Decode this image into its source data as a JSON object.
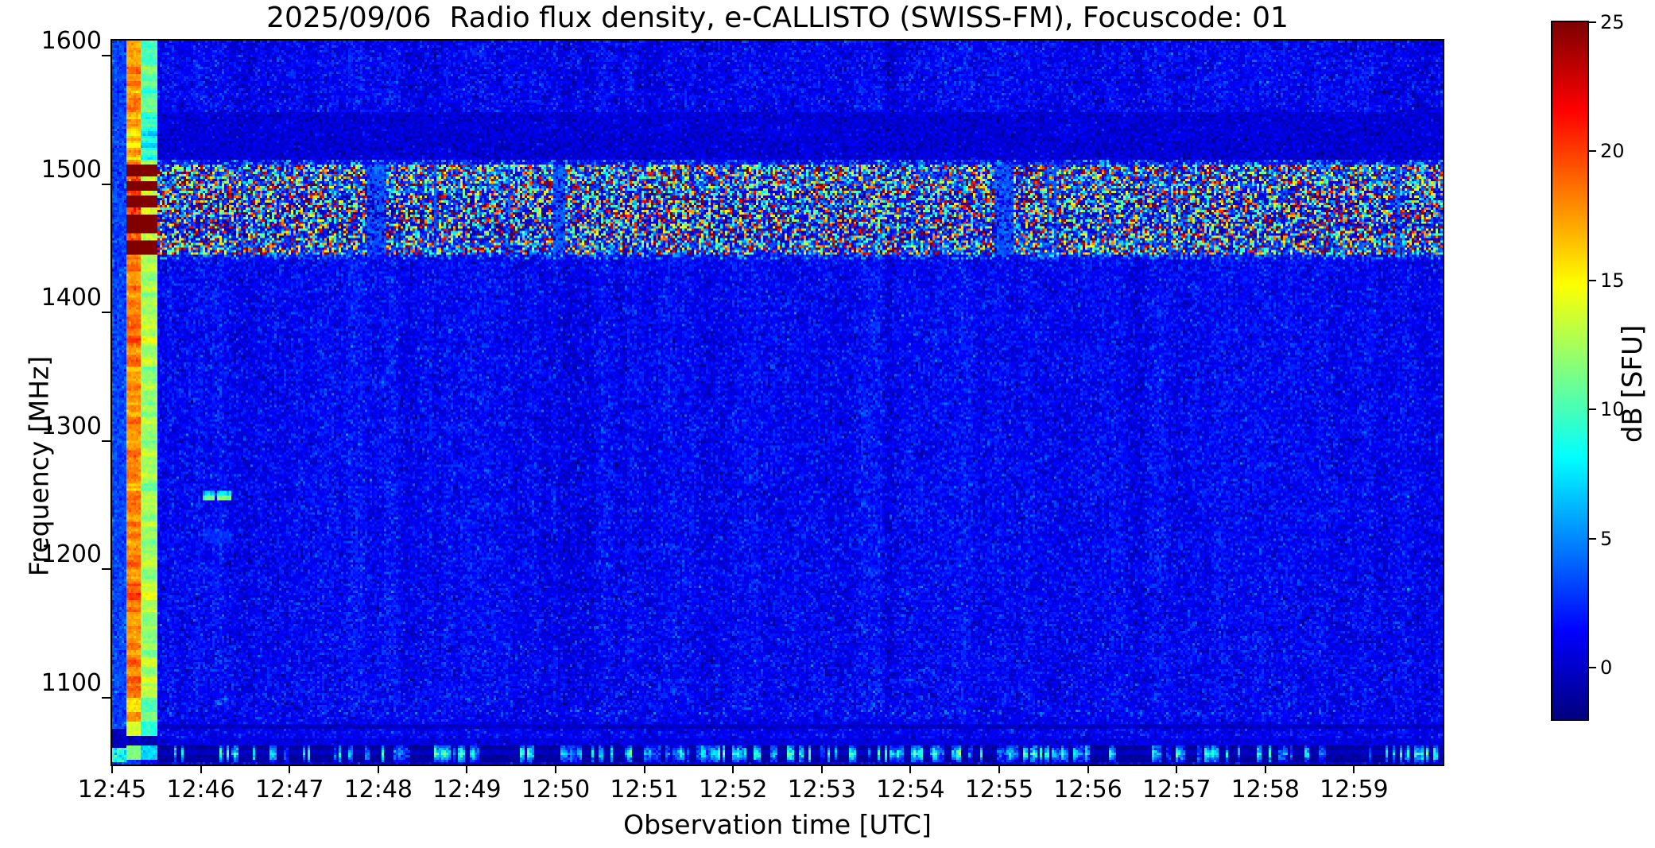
{
  "page": {
    "background": "#ffffff"
  },
  "chart_data": {
    "type": "heatmap",
    "subtype": "radio-spectrogram",
    "title": "2025/09/06  Radio flux density, e-CALLISTO (SWISS-FM), Focuscode: 01",
    "xlabel": "Observation time [UTC]",
    "ylabel": "Frequency [MHz]",
    "colorbar_label": "dB [SFU]",
    "colormap": "jet",
    "grid": false,
    "time_start": "12:45",
    "time_end": "13:00",
    "duration_s": 900,
    "x_ticks": [
      "12:45",
      "12:46",
      "12:47",
      "12:48",
      "12:49",
      "12:50",
      "12:51",
      "12:52",
      "12:53",
      "12:54",
      "12:55",
      "12:56",
      "12:57",
      "12:58",
      "12:59"
    ],
    "y_ticks": [
      1600,
      1500,
      1400,
      1300,
      1200,
      1100
    ],
    "freq_min": 1048,
    "freq_max": 1612,
    "db_min": -2,
    "db_max": 25,
    "colorbar_ticks": [
      25,
      20,
      15,
      10,
      5,
      0
    ],
    "background_db": 1.25,
    "features": [
      {
        "name": "calibration-blue-edge",
        "t_s": [
          0,
          9
        ],
        "db": 3.1,
        "note": "narrow brighter blue column at start"
      },
      {
        "name": "calibration-orange-stripe",
        "t_s": [
          9,
          19
        ],
        "db": 18.3,
        "note": "bright orange calibration column, dark-red blobs inside RFI band"
      },
      {
        "name": "calibration-green-stripe",
        "t_s": [
          19,
          30.5
        ],
        "db": 12.6,
        "note": "yellow-green calibration column"
      },
      {
        "name": "rfi-speckle-band",
        "freq_mhz": [
          1445,
          1515
        ],
        "db_range": [
          -1.5,
          27
        ],
        "note": "speckled interference band across full duration"
      },
      {
        "name": "dark-quiet-band",
        "freq_mhz": [
          1520,
          1557
        ],
        "db": 0.25,
        "wisp_freq_mhz": [
          1536,
          1550
        ]
      },
      {
        "name": "narrow-signal-dash",
        "freq_mhz": [
          1253.5,
          1261
        ],
        "t_s": [
          62,
          81
        ],
        "db": 11.3,
        "db_upper": 7.5,
        "gap_t_s": [
          69.5,
          71.2
        ]
      },
      {
        "name": "faint-smudge",
        "freq_mhz": [
          1220,
          1229
        ],
        "t_s": [
          62,
          81
        ],
        "db": 2.35
      },
      {
        "name": "dotted-row-high",
        "freq_mhz": [
          1087,
          1091
        ],
        "db": 3.0
      },
      {
        "name": "dark-line",
        "freq_mhz": [
          1075,
          1080
        ],
        "db": -0.2
      },
      {
        "name": "bottom-burst-band",
        "freq_mhz": [
          1050,
          1063
        ],
        "db_base": -1.1,
        "streak_db": [
          3.5,
          12
        ],
        "note": "dark band with bright cyan vertical bursts"
      }
    ]
  }
}
